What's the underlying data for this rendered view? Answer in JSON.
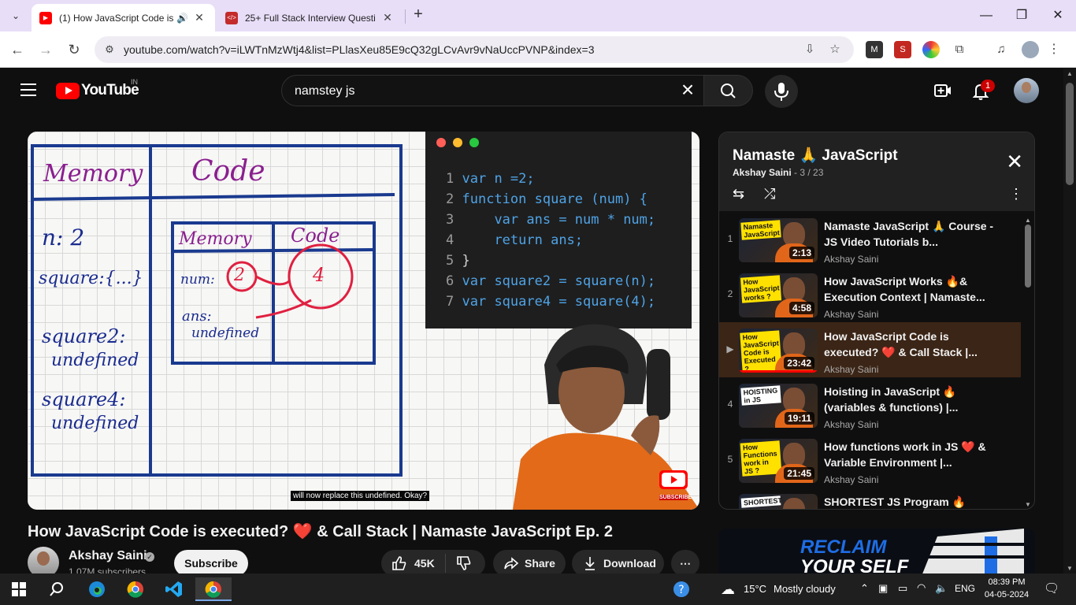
{
  "browser": {
    "tabs": [
      {
        "title": "(1) How JavaScript Code is e",
        "active": true
      },
      {
        "title": "25+ Full Stack Interview Questi",
        "active": false
      }
    ],
    "url": "youtube.com/watch?v=iLWTnMzWtj4&list=PLlasXeu85E9cQ32gLCvAvr9vNaUccPVNP&index=3"
  },
  "header": {
    "logo_text": "YouTube",
    "country": "IN",
    "search_value": "namstey js",
    "notif_count": "1"
  },
  "video": {
    "code_lines": [
      {
        "n": "1",
        "text": "var n =2;"
      },
      {
        "n": "2",
        "text": "function square (num) {"
      },
      {
        "n": "3",
        "text": "    var ans = num * num;"
      },
      {
        "n": "4",
        "text": "    return ans;"
      },
      {
        "n": "5",
        "text": "}"
      },
      {
        "n": "6",
        "text": "var square2 = square(n);"
      },
      {
        "n": "7",
        "text": "var square4 = square(4);"
      }
    ],
    "board": {
      "memory": "Memory",
      "code": "Code",
      "n": "n: 2",
      "square": "square:{...}",
      "square2": "square2:",
      "square2_val": "undefined",
      "square4": "square4:",
      "square4_val": "undefined",
      "inner_memory": "Memory",
      "inner_code": "Code",
      "num": "num:",
      "num_val": "2",
      "ans": "ans:",
      "ans_val": "undefined",
      "four": "4"
    },
    "caption": "will now replace this undefined. Okay?",
    "watermark": "SUBSCRIBE",
    "title": "How JavaScript Code is executed? ❤️ & Call Stack | Namaste JavaScript Ep. 2"
  },
  "channel": {
    "name": "Akshay Saini",
    "subscribers": "1.07M subscribers",
    "subscribe_label": "Subscribe"
  },
  "actions": {
    "likes": "45K",
    "share": "Share",
    "download": "Download"
  },
  "playlist": {
    "title": "Namaste 🙏 JavaScript",
    "author": "Akshay Saini",
    "position": " - 3 / 23",
    "items": [
      {
        "index": "1",
        "title": "Namaste JavaScript 🙏 Course - JS Video Tutorials b...",
        "author": "Akshay Saini",
        "duration": "2:13",
        "tag": "Namaste JavaScript"
      },
      {
        "index": "2",
        "title": "How JavaScript Works 🔥& Execution Context | Namaste...",
        "author": "Akshay Saini",
        "duration": "4:58",
        "tag": "How JavaScript works ?"
      },
      {
        "index": "▶",
        "title": "How JavaScript Code is executed? ❤️ & Call Stack |...",
        "author": "Akshay Saini",
        "duration": "23:42",
        "tag": "How JavaScript Code is Executed ?"
      },
      {
        "index": "4",
        "title": "Hoisting in JavaScript 🔥 (variables & functions) |...",
        "author": "Akshay Saini",
        "duration": "19:11",
        "tag": "HOISTING in JS"
      },
      {
        "index": "5",
        "title": "How functions work in JS ❤️ & Variable Environment |...",
        "author": "Akshay Saini",
        "duration": "21:45",
        "tag": "How Functions work in JS ?"
      },
      {
        "index": "",
        "title": "SHORTEST JS Program 🔥",
        "author": "",
        "duration": "",
        "tag": "SHORTEST"
      }
    ]
  },
  "ad": {
    "line1": "RECLAIM",
    "line2": "YOUR SELF"
  },
  "taskbar": {
    "weather_temp": "15°C",
    "weather_text": "Mostly cloudy",
    "lang": "ENG",
    "time": "08:39 PM",
    "date": "04-05-2024"
  },
  "colors": {
    "accent": "#ff0000",
    "current_item_bg": "#3b2516"
  }
}
